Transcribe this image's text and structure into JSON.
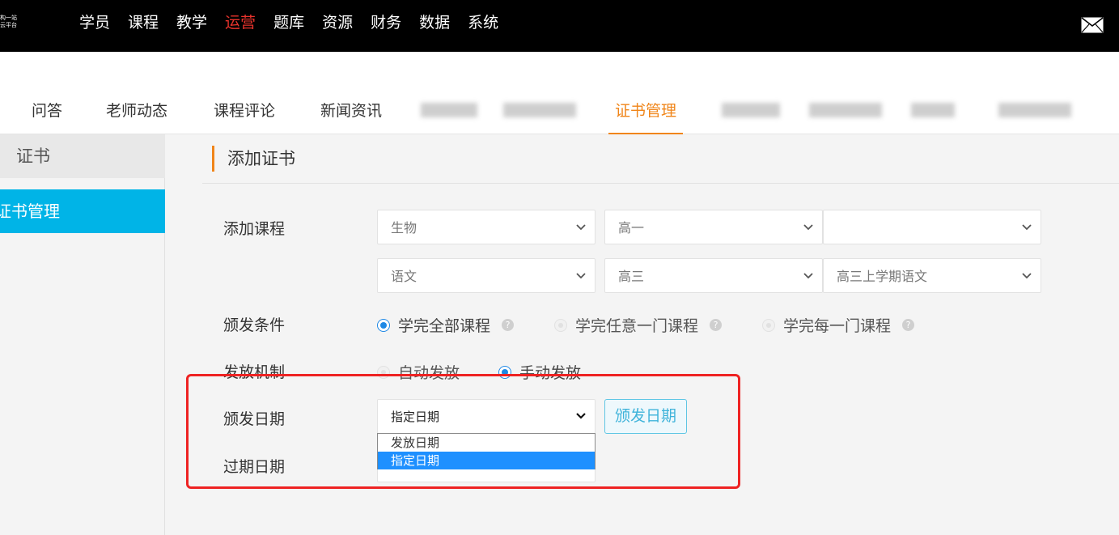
{
  "topbar": {
    "logo_line1": "构一站",
    "logo_line2": "云平台",
    "nav": [
      "学员",
      "课程",
      "教学",
      "运营",
      "题库",
      "资源",
      "财务",
      "数据",
      "系统"
    ],
    "active_nav": "运营"
  },
  "subnav": {
    "tabs": [
      "问答",
      "老师动态",
      "课程评论",
      "新闻资讯",
      "证书管理"
    ],
    "active_tab": "证书管理"
  },
  "sidebar": {
    "header": "证书",
    "item": "证书管理"
  },
  "form": {
    "title": "添加证书",
    "add_course_label": "添加课程",
    "row1": [
      "生物",
      "高一",
      ""
    ],
    "row2": [
      "语文",
      "高三",
      "高三上学期语文"
    ],
    "condition_label": "颁发条件",
    "conditions": [
      "学完全部课程",
      "学完任意一门课程",
      "学完每一门课程"
    ],
    "condition_help": "?",
    "mechanism_label": "发放机制",
    "mechanisms": [
      "自动发放",
      "手动发放"
    ],
    "issue_date_label": "颁发日期",
    "issue_date_value": "指定日期",
    "issue_date_button": "颁发日期",
    "expire_date_label": "过期日期",
    "dropdown_options": [
      "发放日期",
      "指定日期"
    ],
    "dropdown_selected": "指定日期"
  },
  "colors": {
    "accent": "#f08519",
    "sidebar_active": "#00b4e7",
    "nav_active": "#e8332c",
    "highlight_box": "#ee2222"
  }
}
